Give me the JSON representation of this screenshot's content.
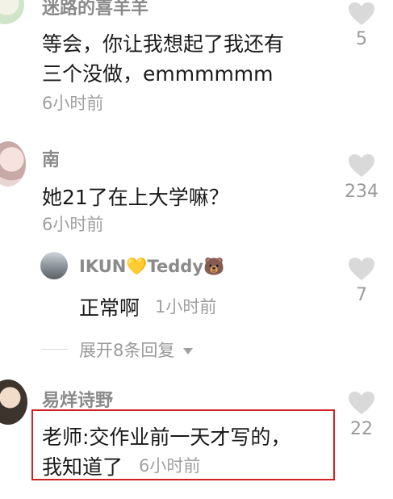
{
  "comments": [
    {
      "username": "迷路的喜羊羊",
      "text_lines": [
        "等会，你让我想起了我还有",
        "三个没做，emmmmmm"
      ],
      "time": "6小时前",
      "likes": "5"
    },
    {
      "username": "南",
      "text_lines": [
        "她21了在上大学嘛？"
      ],
      "time": "6小时前",
      "likes": "234",
      "reply": {
        "username": "IKUN💛Teddy🐻",
        "text": "正常啊",
        "time": "1小时前",
        "likes": "7"
      },
      "expand_label": "展开8条回复"
    },
    {
      "username": "易烊诗野",
      "text_lines": [
        "老师:交作业前一天才写的，",
        "我知道了"
      ],
      "time": "6小时前",
      "likes": "22"
    }
  ],
  "colors": {
    "highlight_border": "#d32020",
    "username": "#8a8a8a",
    "heart": "#d9d9d9"
  }
}
